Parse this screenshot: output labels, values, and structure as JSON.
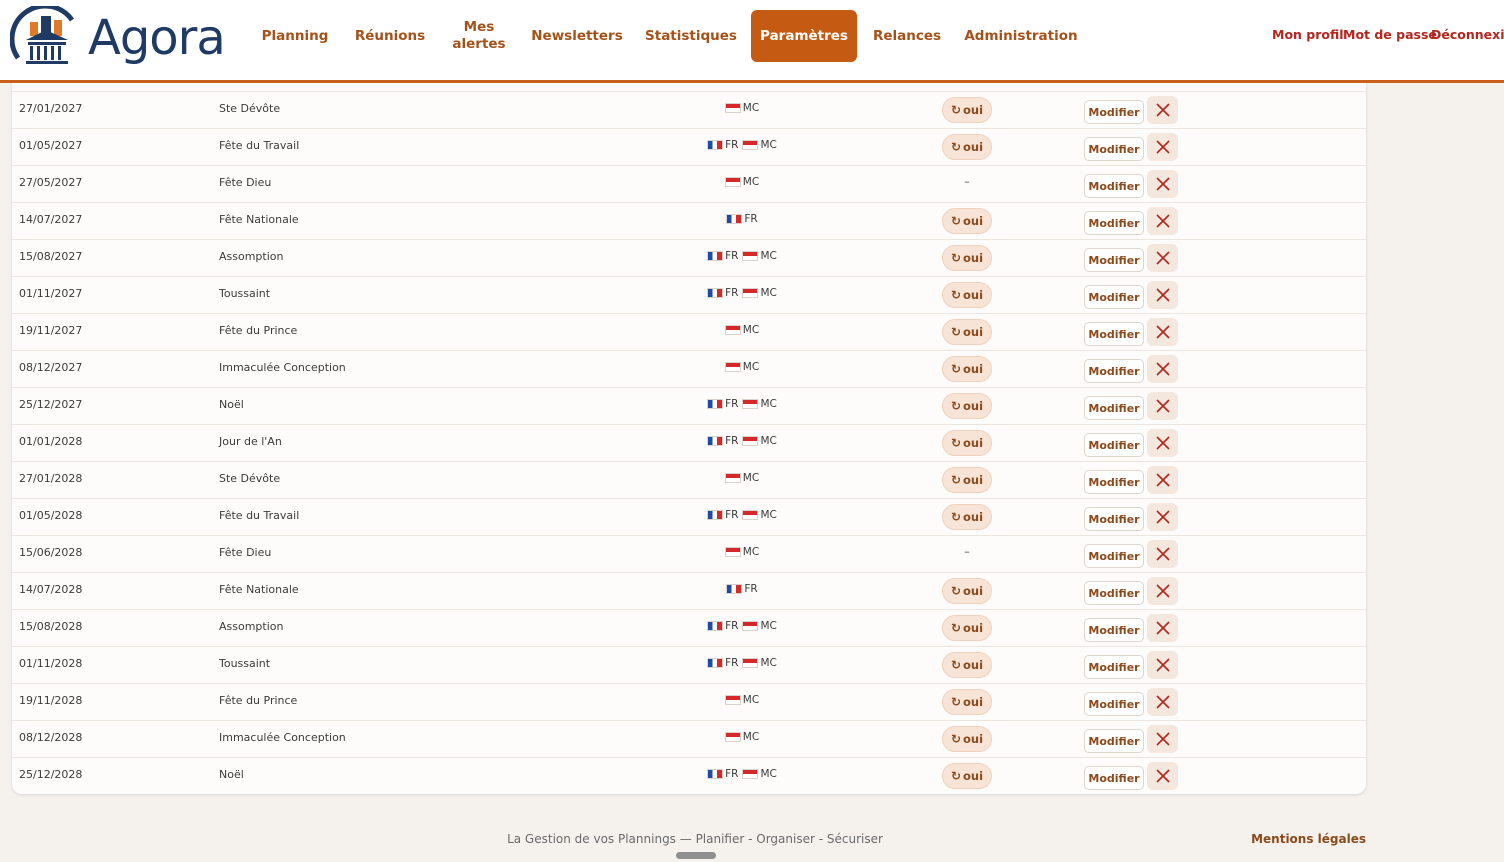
{
  "header": {
    "logo_text": "Agora",
    "nav": [
      {
        "label": "Planning"
      },
      {
        "label": "Réunions"
      },
      {
        "label": "Mes alertes"
      },
      {
        "label": "Newsletters"
      },
      {
        "label": "Statistiques"
      },
      {
        "label": "Paramètres",
        "active": true
      },
      {
        "label": "Relances"
      },
      {
        "label": "Administration"
      }
    ],
    "user_links": {
      "profile": "Mon profil",
      "password": "Mot de passe",
      "logout": "Déconnexion"
    }
  },
  "table": {
    "recur_label": "oui",
    "recur_icon": "refresh-icon",
    "modify_label": "Modifier",
    "delete_icon": "close-icon",
    "none_label": "–",
    "rows": [
      {
        "date": "27/01/2027",
        "name": "Ste Dévôte",
        "countries": [
          "MC"
        ],
        "recurring": true
      },
      {
        "date": "01/05/2027",
        "name": "Fête du Travail",
        "countries": [
          "FR",
          "MC"
        ],
        "recurring": true
      },
      {
        "date": "27/05/2027",
        "name": "Fête Dieu",
        "countries": [
          "MC"
        ],
        "recurring": false
      },
      {
        "date": "14/07/2027",
        "name": "Fête Nationale",
        "countries": [
          "FR"
        ],
        "recurring": true
      },
      {
        "date": "15/08/2027",
        "name": "Assomption",
        "countries": [
          "FR",
          "MC"
        ],
        "recurring": true
      },
      {
        "date": "01/11/2027",
        "name": "Toussaint",
        "countries": [
          "FR",
          "MC"
        ],
        "recurring": true
      },
      {
        "date": "19/11/2027",
        "name": "Fête du Prince",
        "countries": [
          "MC"
        ],
        "recurring": true
      },
      {
        "date": "08/12/2027",
        "name": "Immaculée Conception",
        "countries": [
          "MC"
        ],
        "recurring": true
      },
      {
        "date": "25/12/2027",
        "name": "Noël",
        "countries": [
          "FR",
          "MC"
        ],
        "recurring": true
      },
      {
        "date": "01/01/2028",
        "name": "Jour de l'An",
        "countries": [
          "FR",
          "MC"
        ],
        "recurring": true
      },
      {
        "date": "27/01/2028",
        "name": "Ste Dévôte",
        "countries": [
          "MC"
        ],
        "recurring": true
      },
      {
        "date": "01/05/2028",
        "name": "Fête du Travail",
        "countries": [
          "FR",
          "MC"
        ],
        "recurring": true
      },
      {
        "date": "15/06/2028",
        "name": "Fête Dieu",
        "countries": [
          "MC"
        ],
        "recurring": false
      },
      {
        "date": "14/07/2028",
        "name": "Fête Nationale",
        "countries": [
          "FR"
        ],
        "recurring": true
      },
      {
        "date": "15/08/2028",
        "name": "Assomption",
        "countries": [
          "FR",
          "MC"
        ],
        "recurring": true
      },
      {
        "date": "01/11/2028",
        "name": "Toussaint",
        "countries": [
          "FR",
          "MC"
        ],
        "recurring": true
      },
      {
        "date": "19/11/2028",
        "name": "Fête du Prince",
        "countries": [
          "MC"
        ],
        "recurring": true
      },
      {
        "date": "08/12/2028",
        "name": "Immaculée Conception",
        "countries": [
          "MC"
        ],
        "recurring": true
      },
      {
        "date": "25/12/2028",
        "name": "Noël",
        "countries": [
          "FR",
          "MC"
        ],
        "recurring": true
      }
    ]
  },
  "footer": {
    "tagline": "La Gestion de vos Plannings — Planifier - Organiser - Sécuriser",
    "legal": "Mentions légales"
  },
  "colors": {
    "accent": "#c55a12",
    "nav_text": "#a4521a",
    "user_link": "#b3261e",
    "logo_text": "#1f3b63"
  }
}
